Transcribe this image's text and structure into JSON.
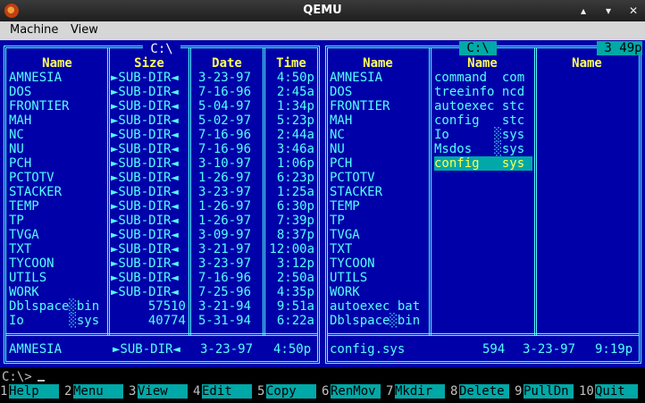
{
  "window": {
    "title": "QEMU"
  },
  "menu": {
    "machine": "Machine",
    "view": "View"
  },
  "left_panel": {
    "path": " C:\\ ",
    "headers": [
      "Name",
      "Size",
      "Date",
      "Time"
    ],
    "rows": [
      {
        "name": "AMNESIA",
        "size": "►SUB-DIR◄",
        "date": "3-23-97",
        "time": "4:50p"
      },
      {
        "name": "DOS",
        "size": "►SUB-DIR◄",
        "date": "7-16-96",
        "time": "2:45a"
      },
      {
        "name": "FRONTIER",
        "size": "►SUB-DIR◄",
        "date": "5-04-97",
        "time": "1:34p"
      },
      {
        "name": "MAH",
        "size": "►SUB-DIR◄",
        "date": "5-02-97",
        "time": "5:23p"
      },
      {
        "name": "NC",
        "size": "►SUB-DIR◄",
        "date": "7-16-96",
        "time": "2:44a"
      },
      {
        "name": "NU",
        "size": "►SUB-DIR◄",
        "date": "7-16-96",
        "time": "3:46a"
      },
      {
        "name": "PCH",
        "size": "►SUB-DIR◄",
        "date": "3-10-97",
        "time": "1:06p"
      },
      {
        "name": "PCTOTV",
        "size": "►SUB-DIR◄",
        "date": "1-26-97",
        "time": "6:23p"
      },
      {
        "name": "STACKER",
        "size": "►SUB-DIR◄",
        "date": "3-23-97",
        "time": "1:25a"
      },
      {
        "name": "TEMP",
        "size": "►SUB-DIR◄",
        "date": "1-26-97",
        "time": "6:30p"
      },
      {
        "name": "TP",
        "size": "►SUB-DIR◄",
        "date": "1-26-97",
        "time": "7:39p"
      },
      {
        "name": "TVGA",
        "size": "►SUB-DIR◄",
        "date": "3-09-97",
        "time": "8:37p"
      },
      {
        "name": "TXT",
        "size": "►SUB-DIR◄",
        "date": "3-21-97",
        "time": "12:00a"
      },
      {
        "name": "TYCOON",
        "size": "►SUB-DIR◄",
        "date": "3-23-97",
        "time": "3:12p"
      },
      {
        "name": "UTILS",
        "size": "►SUB-DIR◄",
        "date": "7-16-96",
        "time": "2:50a"
      },
      {
        "name": "WORK",
        "size": "►SUB-DIR◄",
        "date": "7-25-96",
        "time": "4:35p"
      },
      {
        "name": "Dblspace░bin",
        "size": "57510",
        "date": "3-21-94",
        "time": "9:51a"
      },
      {
        "name": "Io      ░sys",
        "size": "40774",
        "date": "5-31-94",
        "time": "6:22a"
      }
    ],
    "status": {
      "name": "AMNESIA",
      "size": "►SUB-DIR◄",
      "date": "3-23-97",
      "time": "4:50p"
    }
  },
  "right_panel": {
    "path": " C:\\ ",
    "clock": " 3 49p",
    "headers": [
      "Name",
      "Name",
      "Name"
    ],
    "col1": [
      "AMNESIA",
      "DOS",
      "FRONTIER",
      "MAH",
      "NC",
      "NU",
      "PCH",
      "PCTOTV",
      "STACKER",
      "TEMP",
      "TP",
      "TVGA",
      "TXT",
      "TYCOON",
      "UTILS",
      "WORK",
      "autoexec bat",
      "Dblspace░bin"
    ],
    "col2": [
      "command  com",
      "treeinfo ncd",
      "autoexec stc",
      "config   stc",
      "Io      ░sys",
      "Msdos   ░sys",
      "config   sys"
    ],
    "selected_index": 6,
    "status": {
      "name": "config.sys",
      "size": "594",
      "date": "3-23-97",
      "time": "9:19p"
    }
  },
  "command_line": {
    "prompt": "C:\\>"
  },
  "function_keys": [
    {
      "num": "1",
      "label": "Help"
    },
    {
      "num": "2",
      "label": "Menu"
    },
    {
      "num": "3",
      "label": "View"
    },
    {
      "num": "4",
      "label": "Edit"
    },
    {
      "num": "5",
      "label": "Copy"
    },
    {
      "num": "6",
      "label": "RenMov"
    },
    {
      "num": "7",
      "label": "Mkdir"
    },
    {
      "num": "8",
      "label": "Delete"
    },
    {
      "num": "9",
      "label": "PullDn"
    },
    {
      "num": "10",
      "label": "Quit"
    }
  ],
  "colors": {
    "panel_bg": "#0000a8",
    "text": "#54ffff",
    "header": "#ffff55",
    "highlight": "#00a8a8"
  }
}
